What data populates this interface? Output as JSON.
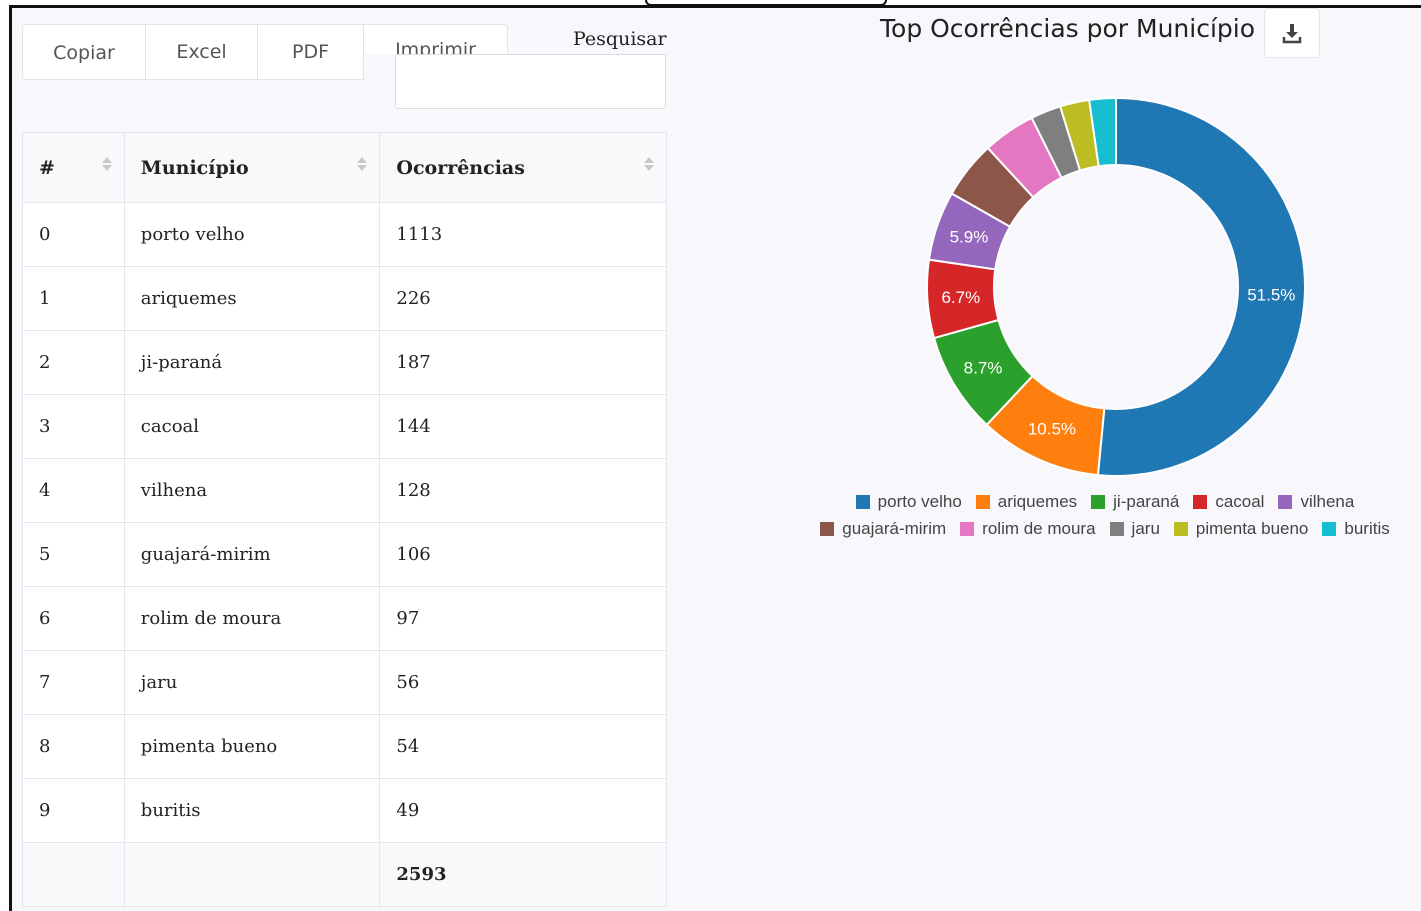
{
  "toolbar": {
    "copy_label": "Copiar",
    "excel_label": "Excel",
    "pdf_label": "PDF",
    "print_label": "Imprimir"
  },
  "search": {
    "label": "Pesquisar",
    "value": ""
  },
  "table": {
    "headers": [
      "#",
      "Município",
      "Ocorrências"
    ],
    "rows": [
      {
        "idx": "0",
        "municipio": "porto velho",
        "ocorrencias": "1113"
      },
      {
        "idx": "1",
        "municipio": "ariquemes",
        "ocorrencias": "226"
      },
      {
        "idx": "2",
        "municipio": "ji-paraná",
        "ocorrencias": "187"
      },
      {
        "idx": "3",
        "municipio": "cacoal",
        "ocorrencias": "144"
      },
      {
        "idx": "4",
        "municipio": "vilhena",
        "ocorrencias": "128"
      },
      {
        "idx": "5",
        "municipio": "guajará-mirim",
        "ocorrencias": "106"
      },
      {
        "idx": "6",
        "municipio": "rolim de moura",
        "ocorrencias": "97"
      },
      {
        "idx": "7",
        "municipio": "jaru",
        "ocorrencias": "56"
      },
      {
        "idx": "8",
        "municipio": "pimenta bueno",
        "ocorrencias": "54"
      },
      {
        "idx": "9",
        "municipio": "buritis",
        "ocorrencias": "49"
      }
    ],
    "total": "2593"
  },
  "chart": {
    "title": "Top Ocorrências por Município",
    "download_icon": "download-icon"
  },
  "chart_data": {
    "type": "pie",
    "title": "Top Ocorrências por Município",
    "categories": [
      "porto velho",
      "ariquemes",
      "ji-paraná",
      "cacoal",
      "vilhena",
      "guajará-mirim",
      "rolim de moura",
      "jaru",
      "pimenta bueno",
      "buritis"
    ],
    "values": [
      1113,
      226,
      187,
      144,
      128,
      106,
      97,
      56,
      54,
      49
    ],
    "slice_labels": [
      "51.5%",
      "10.5%",
      "8.7%",
      "6.7%",
      "5.9%",
      "",
      "",
      "",
      "",
      ""
    ],
    "colors": [
      "#1f77b4",
      "#ff7f0e",
      "#2ca02c",
      "#d62728",
      "#9467bd",
      "#8c564b",
      "#e377c2",
      "#7f7f7f",
      "#bcbd22",
      "#17becf"
    ],
    "legend_position": "bottom"
  }
}
